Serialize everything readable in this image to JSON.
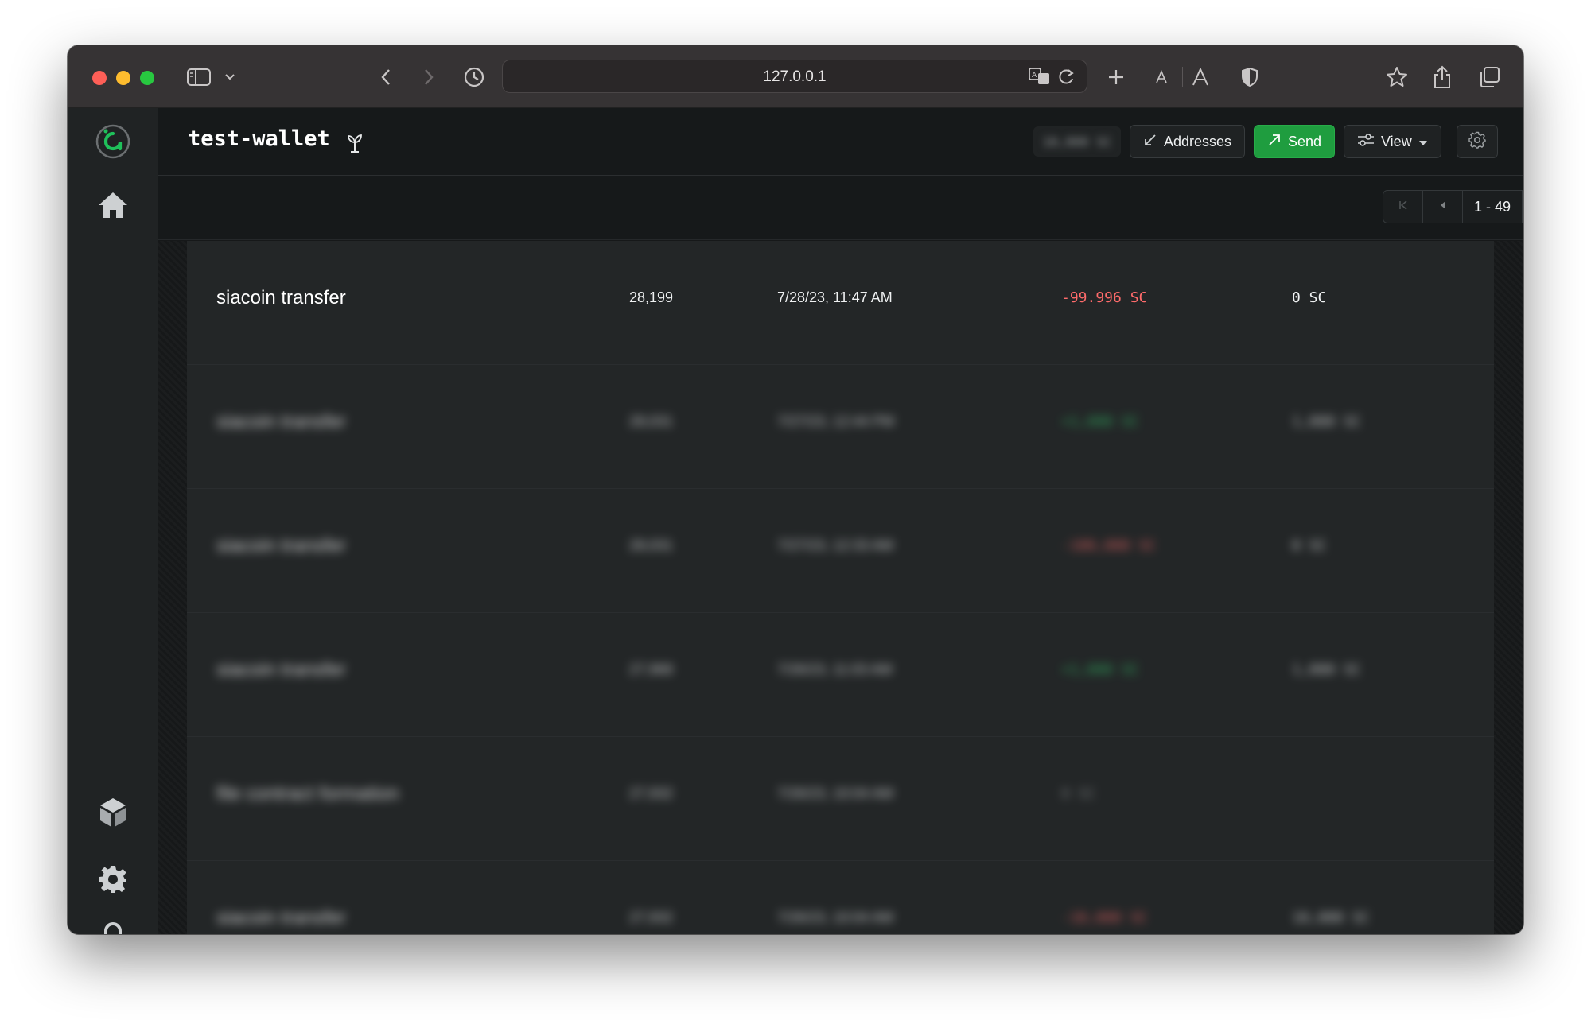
{
  "browser": {
    "url": "127.0.0.1"
  },
  "header": {
    "wallet_name": "test-wallet",
    "balance": "10,000 SC",
    "addresses_label": "Addresses",
    "send_label": "Send",
    "view_label": "View"
  },
  "pager": {
    "range": "1 - 49"
  },
  "colors": {
    "accent_green": "#1f9d3f",
    "negative": "#ff6b6b",
    "positive": "#34c76b"
  },
  "transactions": [
    {
      "type": "siacoin transfer",
      "height": "28,199",
      "timestamp": "7/28/23, 11:47 AM",
      "amount": "-99.996 SC",
      "fee": "0 SC"
    },
    {
      "type": "siacoin transfer",
      "height": "28,031",
      "timestamp": "7/27/23, 12:44 PM",
      "amount": "+1,000 SC",
      "fee": "1,000 SC"
    },
    {
      "type": "siacoin transfer",
      "height": "28,031",
      "timestamp": "7/27/23, 12:33 AM",
      "amount": "-100,000 SC",
      "fee": "0 SC"
    },
    {
      "type": "siacoin transfer",
      "height": "27,968",
      "timestamp": "7/26/23, 11:03 AM",
      "amount": "+1,000 SC",
      "fee": "1,000 SC"
    },
    {
      "type": "file contract formation",
      "height": "27,932",
      "timestamp": "7/26/23, 10:04 AM",
      "amount": "0 SC",
      "fee": ""
    },
    {
      "type": "siacoin transfer",
      "height": "27,932",
      "timestamp": "7/26/23, 10:04 AM",
      "amount": "-10,000 SC",
      "fee": "10,000 SC"
    }
  ]
}
